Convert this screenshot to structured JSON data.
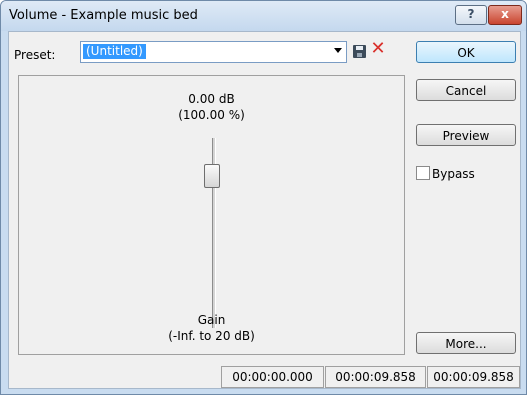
{
  "window": {
    "title": "Volume - Example music bed"
  },
  "titlebar": {
    "help_label": "?",
    "close_label": "x"
  },
  "preset": {
    "label": "Preset:",
    "value": "(Untitled)"
  },
  "buttons": {
    "ok": "OK",
    "cancel": "Cancel",
    "preview": "Preview",
    "more": "More..."
  },
  "bypass": {
    "label": "Bypass",
    "checked": false
  },
  "gain": {
    "value_db": "0.00 dB",
    "value_pct": "(100.00 %)",
    "name": "Gain",
    "range": "(-Inf. to 20 dB)"
  },
  "status": {
    "time_start": "00:00:00.000",
    "time_end": "00:00:09.858",
    "time_length": "00:00:09.858"
  },
  "colors": {
    "titlebar": "#c9dcf0",
    "selection": "#3399ff",
    "delete": "#d9302b"
  },
  "icons": [
    "help-icon",
    "close-icon",
    "dropdown-arrow-icon",
    "save-icon",
    "delete-icon"
  ]
}
